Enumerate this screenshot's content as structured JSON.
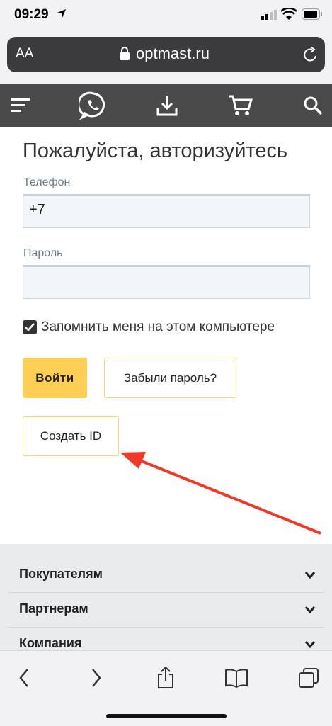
{
  "status_bar": {
    "time": "09:29"
  },
  "browser": {
    "text_size_label": "AA",
    "url": "optmast.ru"
  },
  "site_header": {
    "icons": [
      "menu-icon",
      "whatsapp-icon",
      "download-icon",
      "cart-icon",
      "search-icon"
    ]
  },
  "login": {
    "title": "Пожалуйста, авторизуйтесь",
    "phone_label": "Телефон",
    "phone_value": "+7",
    "password_label": "Пароль",
    "password_value": "",
    "remember_checked": true,
    "remember_label": "Запомнить меня на этом компьютере",
    "login_button": "Войти",
    "forgot_button": "Забыли пароль?",
    "create_id_button": "Создать ID"
  },
  "footer": {
    "sections": [
      "Покупателям",
      "Партнерам",
      "Компания"
    ]
  },
  "colors": {
    "accent": "#ffcf55",
    "header_bg": "#4a4a4a",
    "arrow": "#f0392b"
  }
}
